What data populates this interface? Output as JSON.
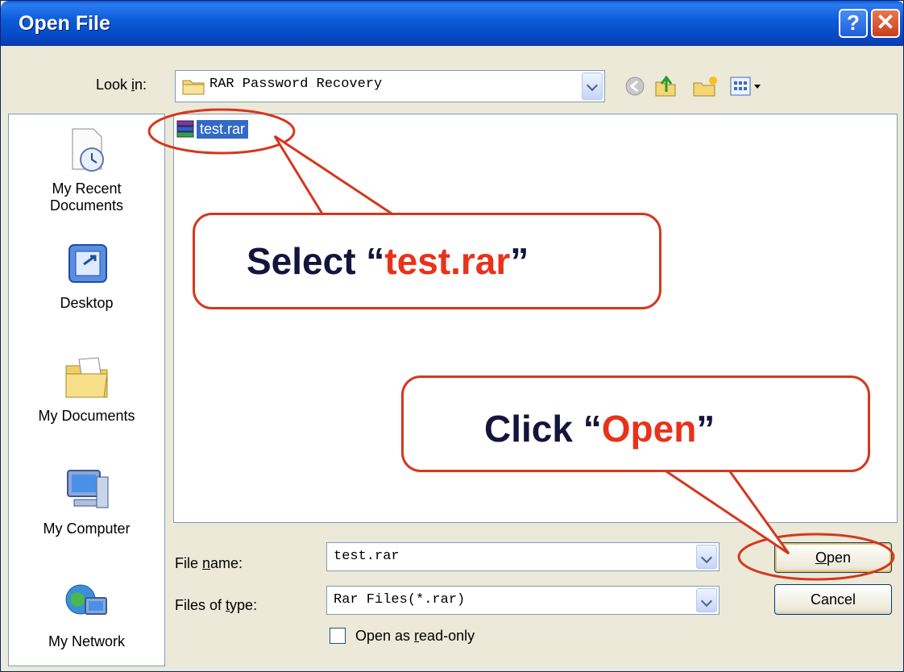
{
  "window": {
    "title": "Open File"
  },
  "look_in": {
    "label_pre": "Look ",
    "label_u": "i",
    "label_post": "n:",
    "value": "RAR Password Recovery"
  },
  "places": [
    {
      "line1": "My Recent",
      "line2": "Documents",
      "icon": "recent-documents-icon"
    },
    {
      "line1": "Desktop",
      "line2": "",
      "icon": "desktop-icon"
    },
    {
      "line1": "My Documents",
      "line2": "",
      "icon": "my-documents-icon"
    },
    {
      "line1": "My Computer",
      "line2": "",
      "icon": "my-computer-icon"
    },
    {
      "line1": "My Network",
      "line2": "",
      "icon": "my-network-icon"
    }
  ],
  "files": [
    {
      "name": "test.rar",
      "icon": "rar-archive-icon",
      "selected": true
    }
  ],
  "file_name": {
    "label_pre": "File ",
    "label_u": "n",
    "label_post": "ame:",
    "value": "test.rar"
  },
  "file_type": {
    "label_pre": "Files of ",
    "label_u": "t",
    "label_post": "ype:",
    "value": "Rar Files(*.rar)"
  },
  "read_only": {
    "label_pre": "Open as ",
    "label_u": "r",
    "label_post": "ead-only",
    "checked": false
  },
  "buttons": {
    "open_u": "O",
    "open_rest": "pen",
    "cancel": "Cancel"
  },
  "annotations": {
    "select": {
      "pre": "Select “",
      "highlight": "test.rar",
      "post": "”"
    },
    "click": {
      "pre": "Click “",
      "highlight": "Open",
      "post": "”"
    }
  },
  "colors": {
    "annotation_red": "#d4381e",
    "selection_blue": "#316ac5",
    "titlebar_blue": "#0a5ad8"
  }
}
